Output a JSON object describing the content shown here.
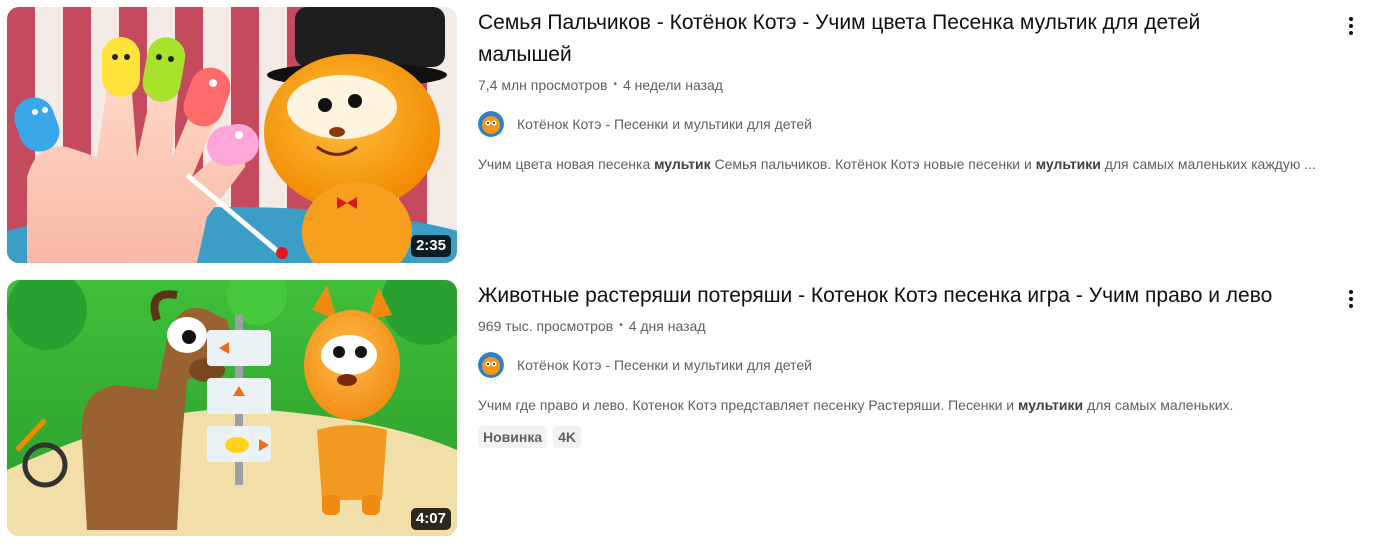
{
  "videos": [
    {
      "title": "Семья Пальчиков - Котёнок Котэ - Учим цвета Песенка мультик для детей малышей",
      "views": "7,4 млн просмотров",
      "age": "4 недели назад",
      "channel": "Котёнок Котэ - Песенки и мультики для детей",
      "description_parts": {
        "p1": "Учим цвета новая песенка ",
        "b1": "мультик",
        "p2": " Семья пальчиков. Котёнок Котэ новые песенки и ",
        "b2": "мультики",
        "p3": " для самых маленьких каждую ..."
      },
      "duration": "2:35",
      "thumbnail_icon": "finger-family-cat-thumbnail"
    },
    {
      "title": "Животные растеряши потеряши - Котенок Котэ песенка игра - Учим право и лево",
      "views": "969 тыс. просмотров",
      "age": "4 дня назад",
      "channel": "Котёнок Котэ - Песенки и мультики для детей",
      "description_parts": {
        "p1": "Учим где право и лево. Котенок Котэ представляет песенку Растеряши. Песенки и ",
        "b1": "мультики",
        "p2": " для самых маленьких."
      },
      "badges": [
        "Новинка",
        "4K"
      ],
      "duration": "4:07",
      "thumbnail_icon": "horse-cat-signpost-thumbnail"
    }
  ],
  "separator": "•",
  "icons": {
    "menu": "more-vert-icon",
    "avatar": "channel-avatar-cat"
  },
  "colors": {
    "text_primary": "#0f0f0f",
    "text_secondary": "#606060",
    "badge_bg": "#f2f2f2",
    "duration_bg": "#000000"
  }
}
